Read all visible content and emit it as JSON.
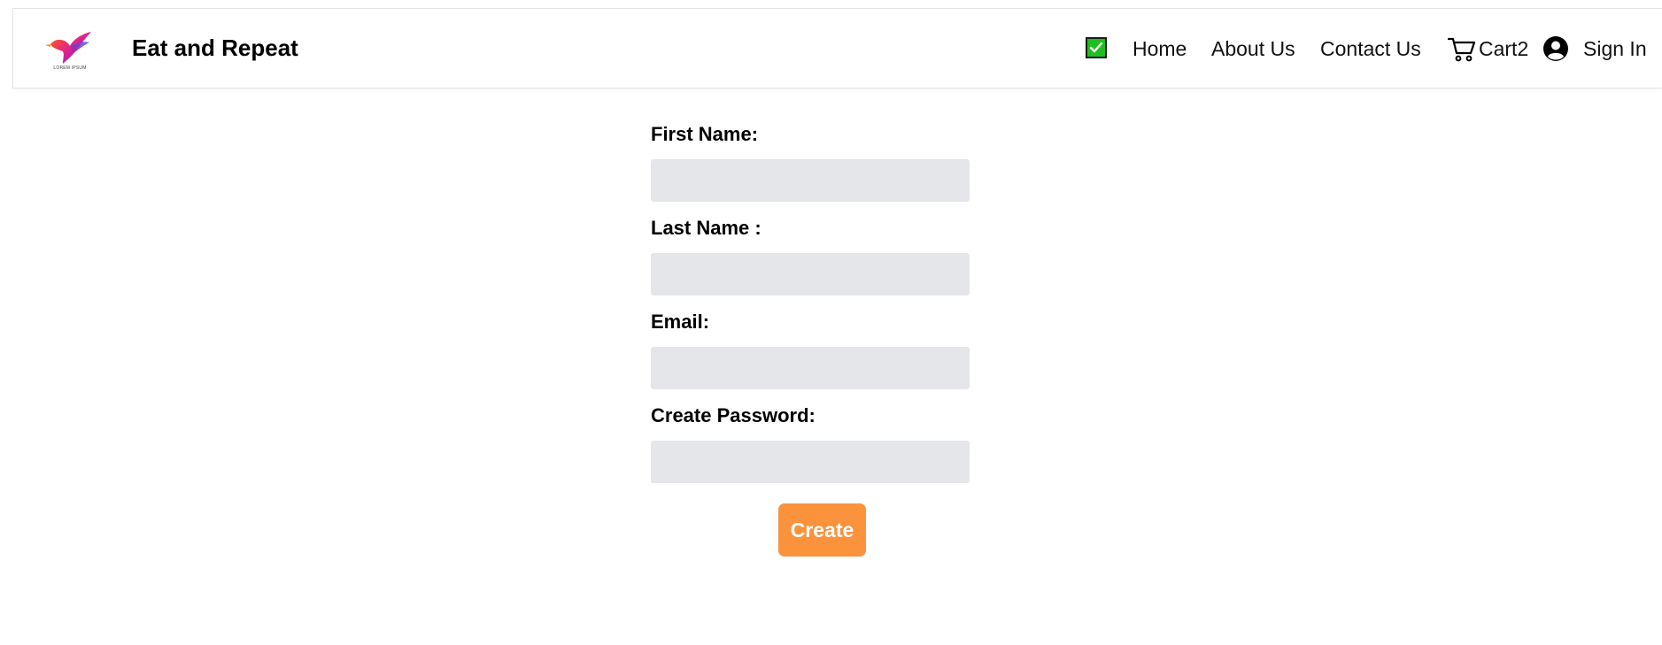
{
  "header": {
    "logo_text": "LOREM IPSUM",
    "brand": "Eat and Repeat",
    "nav": {
      "home": "Home",
      "about": "About Us",
      "contact": "Contact Us",
      "cart_label": "Cart",
      "cart_count": "2",
      "sign_in": "Sign In"
    },
    "icons": {
      "checkbox": "checkbox-checked-icon",
      "cart": "cart-icon",
      "user": "user-circle-icon"
    }
  },
  "form": {
    "fields": [
      {
        "label": "First Name:",
        "value": ""
      },
      {
        "label": "Last Name :",
        "value": ""
      },
      {
        "label": "Email:",
        "value": ""
      },
      {
        "label": "Create Password:",
        "value": ""
      }
    ],
    "submit_label": "Create"
  },
  "colors": {
    "accent": "#fb923c",
    "input_bg": "#e5e6e9",
    "check_green": "#1fbf1f"
  }
}
